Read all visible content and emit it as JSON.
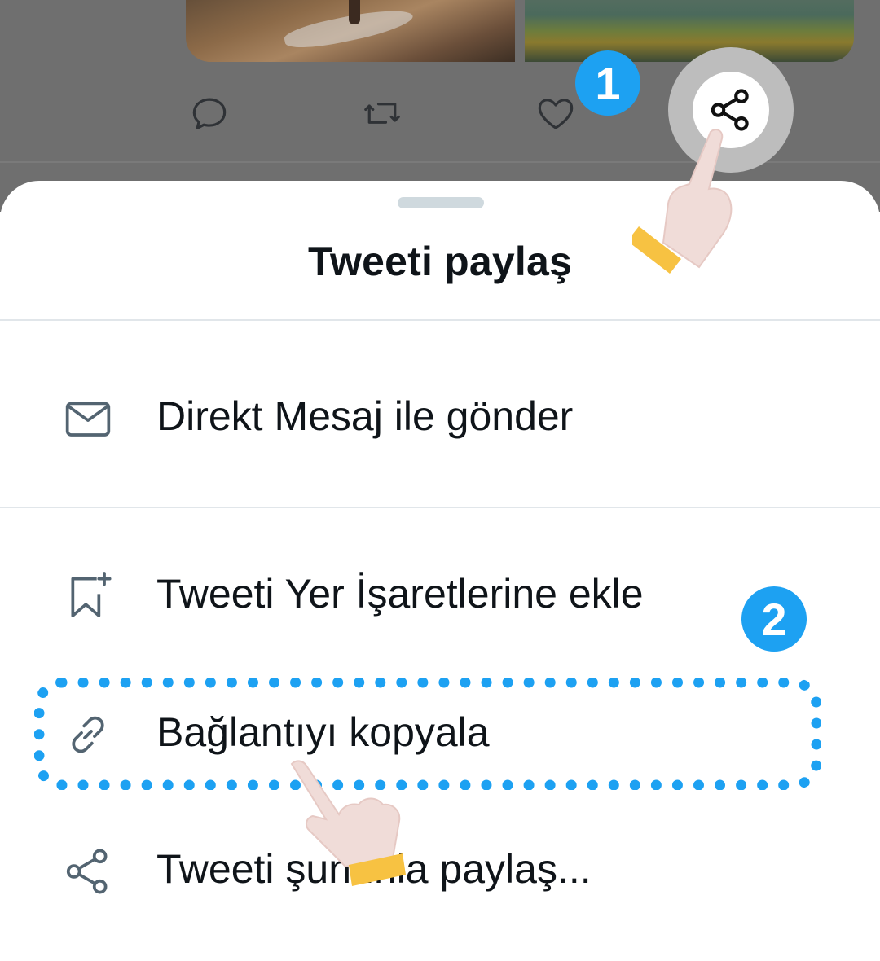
{
  "colors": {
    "accent": "#1da1f2",
    "text": "#0f1419",
    "icon": "#536471",
    "cuff": "#f7c242",
    "skin": "#f0dcd8"
  },
  "tweet_actions": [
    {
      "name": "reply",
      "icon": "reply-icon"
    },
    {
      "name": "retweet",
      "icon": "retweet-icon"
    },
    {
      "name": "like",
      "icon": "heart-icon"
    },
    {
      "name": "share",
      "icon": "share-icon"
    }
  ],
  "steps": {
    "step1": "1",
    "step2": "2"
  },
  "sheet": {
    "title": "Tweeti paylaş",
    "items": [
      {
        "label": "Direkt Mesaj ile gönder",
        "icon": "mail-icon"
      },
      {
        "label": "Tweeti Yer İşaretlerine ekle",
        "icon": "bookmark-add-icon"
      },
      {
        "label": "Bağlantıyı kopyala",
        "icon": "link-icon"
      },
      {
        "label": "Tweeti şununla paylaş...",
        "icon": "share-icon"
      }
    ]
  }
}
